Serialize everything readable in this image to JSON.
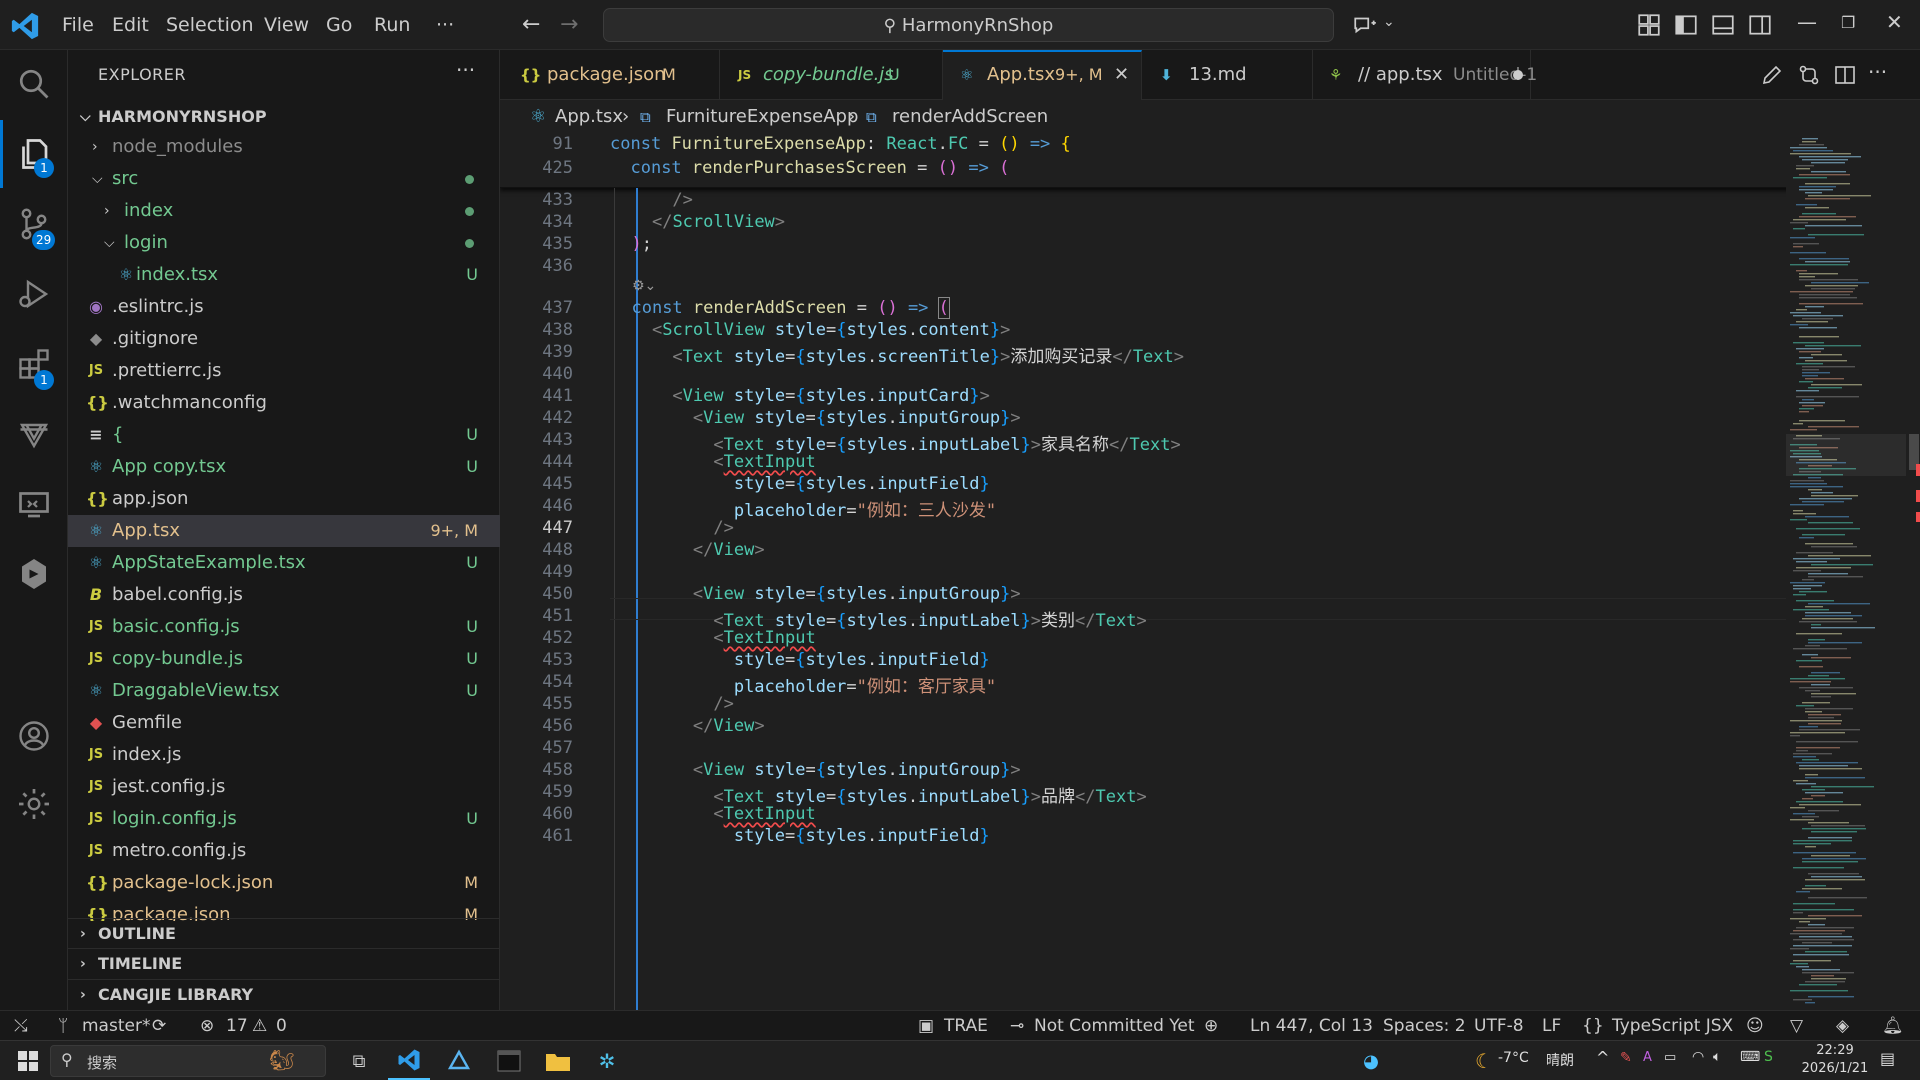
{
  "titlebar": {
    "menus": [
      "File",
      "Edit",
      "Selection",
      "View",
      "Go",
      "Run",
      "···"
    ],
    "search_text": "HarmonyRnShop"
  },
  "activity": {
    "explorer_badge": "1",
    "scm_badge": "29",
    "extensions_badge": "1"
  },
  "sidebar": {
    "title": "EXPLORER",
    "project": "HARMONYRNSHOP",
    "items": [
      {
        "name": "node_modules",
        "status": ""
      },
      {
        "name": "src",
        "status": ""
      },
      {
        "name": "index",
        "status": ""
      },
      {
        "name": "login",
        "status": ""
      },
      {
        "name": "index.tsx",
        "status": "U"
      },
      {
        "name": ".eslintrc.js",
        "status": ""
      },
      {
        "name": ".gitignore",
        "status": ""
      },
      {
        "name": ".prettierrc.js",
        "status": ""
      },
      {
        "name": ".watchmanconfig",
        "status": ""
      },
      {
        "name": "{",
        "status": "U"
      },
      {
        "name": "App copy.tsx",
        "status": "U"
      },
      {
        "name": "app.json",
        "status": ""
      },
      {
        "name": "App.tsx",
        "status": "9+, M"
      },
      {
        "name": "AppStateExample.tsx",
        "status": "U"
      },
      {
        "name": "babel.config.js",
        "status": ""
      },
      {
        "name": "basic.config.js",
        "status": "U"
      },
      {
        "name": "copy-bundle.js",
        "status": "U"
      },
      {
        "name": "DraggableView.tsx",
        "status": "U"
      },
      {
        "name": "Gemfile",
        "status": ""
      },
      {
        "name": "index.js",
        "status": ""
      },
      {
        "name": "jest.config.js",
        "status": ""
      },
      {
        "name": "login.config.js",
        "status": "U"
      },
      {
        "name": "metro.config.js",
        "status": ""
      },
      {
        "name": "package-lock.json",
        "status": "M"
      },
      {
        "name": "package.json",
        "status": "M"
      }
    ],
    "sections": [
      "OUTLINE",
      "TIMELINE",
      "CANGJIE LIBRARY"
    ]
  },
  "tabs": [
    {
      "name": "package.json",
      "status": "M"
    },
    {
      "name": "copy-bundle.js",
      "status": "U"
    },
    {
      "name": "App.tsx",
      "status": "9+, M"
    },
    {
      "name": "13.md",
      "status": ""
    },
    {
      "name": "// app.tsx",
      "status": "Untitled-1"
    }
  ],
  "breadcrumb": [
    "App.tsx",
    "FurnitureExpenseApp",
    "renderAddScreen"
  ],
  "editor": {
    "sticky_lines": [
      "91",
      "425"
    ],
    "line_numbers": [
      "433",
      "434",
      "435",
      "436",
      "437",
      "438",
      "439",
      "440",
      "441",
      "442",
      "443",
      "444",
      "445",
      "446",
      "447",
      "448",
      "449",
      "450",
      "451",
      "452",
      "453",
      "454",
      "455",
      "456",
      "457",
      "458",
      "459",
      "460",
      "461"
    ],
    "strings": {
      "title_add": "添加购买记录",
      "label_name": "家具名称",
      "ph_name": "\"例如：三人沙发\"",
      "label_cat": "类别",
      "ph_cat": "\"例如：客厅家具\"",
      "label_brand": "品牌"
    }
  },
  "statusbar": {
    "branch": "master*",
    "errors": "17",
    "warnings": "0",
    "trae": "TRAE",
    "commit": "Not Committed Yet",
    "position": "Ln 447, Col 13",
    "spaces": "Spaces: 2",
    "encoding": "UTF-8",
    "eol": "LF",
    "language": "TypeScript JSX"
  },
  "taskbar": {
    "search_placeholder": "搜索",
    "weather_temp": "-7°C",
    "weather_desc": "晴朗",
    "time": "22:29",
    "date": "2026/1/21"
  },
  "colors": {
    "accent": "#0078d4",
    "git_untracked": "#73c991",
    "git_modified": "#e2c08d"
  }
}
